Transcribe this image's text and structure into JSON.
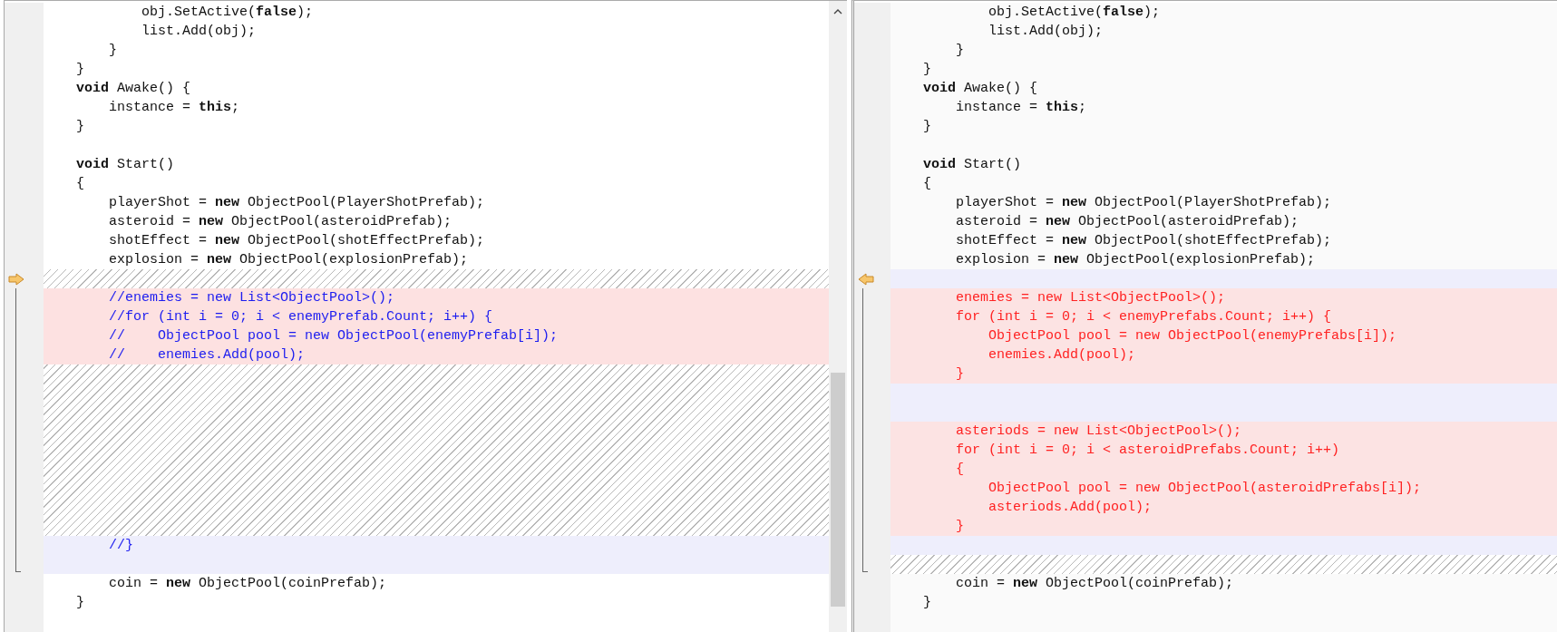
{
  "panes": [
    {
      "kind": "left",
      "lines": [
        {
          "kind": "same",
          "text": "            obj.SetActive(**false**);"
        },
        {
          "kind": "same",
          "text": "            list.Add(obj);"
        },
        {
          "kind": "same",
          "text": "        }"
        },
        {
          "kind": "same",
          "text": "    }"
        },
        {
          "kind": "same",
          "text": "    **void** Awake() {"
        },
        {
          "kind": "same",
          "text": "        instance = **this**;"
        },
        {
          "kind": "same",
          "text": "    }"
        },
        {
          "kind": "same"
        },
        {
          "kind": "same",
          "text": "    **void** Start()"
        },
        {
          "kind": "same",
          "text": "    {"
        },
        {
          "kind": "same",
          "text": "        playerShot = **new** ObjectPool(PlayerShotPrefab);"
        },
        {
          "kind": "same",
          "text": "        asteroid = **new** ObjectPool(asteroidPrefab);"
        },
        {
          "kind": "same",
          "text": "        shotEffect = **new** ObjectPool(shotEffectPrefab);"
        },
        {
          "kind": "same",
          "text": "        explosion = **new** ObjectPool(explosionPrefab);"
        },
        {
          "kind": "hatch"
        },
        {
          "kind": "changed",
          "text": "        //enemies = new List<ObjectPool>();"
        },
        {
          "kind": "changed",
          "text": "        //for (int i = 0; i < enemyPrefab.Count; i++) {"
        },
        {
          "kind": "changed",
          "text": "        //    ObjectPool pool = new ObjectPool(enemyPrefab[i]);"
        },
        {
          "kind": "changed",
          "text": "        //    enemies.Add(pool);"
        },
        {
          "kind": "hatch"
        },
        {
          "kind": "hatch"
        },
        {
          "kind": "hatch"
        },
        {
          "kind": "hatch"
        },
        {
          "kind": "hatch"
        },
        {
          "kind": "hatch"
        },
        {
          "kind": "hatch"
        },
        {
          "kind": "hatch"
        },
        {
          "kind": "hatch"
        },
        {
          "kind": "blank",
          "text": "        //}"
        },
        {
          "kind": "blank"
        },
        {
          "kind": "same",
          "text": "        coin = **new** ObjectPool(coinPrefab);"
        },
        {
          "kind": "same",
          "text": "    }"
        },
        {
          "kind": "same"
        }
      ]
    },
    {
      "kind": "right",
      "lines": [
        {
          "kind": "same",
          "text": "            obj.SetActive(**false**);"
        },
        {
          "kind": "same",
          "text": "            list.Add(obj);"
        },
        {
          "kind": "same",
          "text": "        }"
        },
        {
          "kind": "same",
          "text": "    }"
        },
        {
          "kind": "same",
          "text": "    **void** Awake() {"
        },
        {
          "kind": "same",
          "text": "        instance = **this**;"
        },
        {
          "kind": "same",
          "text": "    }"
        },
        {
          "kind": "same"
        },
        {
          "kind": "same",
          "text": "    **void** Start()"
        },
        {
          "kind": "same",
          "text": "    {"
        },
        {
          "kind": "same",
          "text": "        playerShot = **new** ObjectPool(PlayerShotPrefab);"
        },
        {
          "kind": "same",
          "text": "        asteroid = **new** ObjectPool(asteroidPrefab);"
        },
        {
          "kind": "same",
          "text": "        shotEffect = **new** ObjectPool(shotEffectPrefab);"
        },
        {
          "kind": "same",
          "text": "        explosion = **new** ObjectPool(explosionPrefab);"
        },
        {
          "kind": "blank"
        },
        {
          "kind": "changed",
          "text": "        enemies = new List<ObjectPool>();"
        },
        {
          "kind": "changed",
          "text": "        for (int i = 0; i < enemyPrefabs.Count; i++) {"
        },
        {
          "kind": "changed",
          "text": "            ObjectPool pool = new ObjectPool(enemyPrefabs[i]);"
        },
        {
          "kind": "changed",
          "text": "            enemies.Add(pool);"
        },
        {
          "kind": "changed",
          "text": "        }"
        },
        {
          "kind": "blank"
        },
        {
          "kind": "blank"
        },
        {
          "kind": "changed",
          "text": "        asteriods = new List<ObjectPool>();"
        },
        {
          "kind": "changed",
          "text": "        for (int i = 0; i < asteroidPrefabs.Count; i++)"
        },
        {
          "kind": "changed",
          "text": "        {"
        },
        {
          "kind": "changed",
          "text": "            ObjectPool pool = new ObjectPool(asteroidPrefabs[i]);"
        },
        {
          "kind": "changed",
          "text": "            asteriods.Add(pool);"
        },
        {
          "kind": "changed",
          "text": "        }"
        },
        {
          "kind": "blank"
        },
        {
          "kind": "hatch"
        },
        {
          "kind": "same",
          "text": "        coin = **new** ObjectPool(coinPrefab);"
        },
        {
          "kind": "same",
          "text": "    }"
        },
        {
          "kind": "same"
        }
      ]
    }
  ]
}
